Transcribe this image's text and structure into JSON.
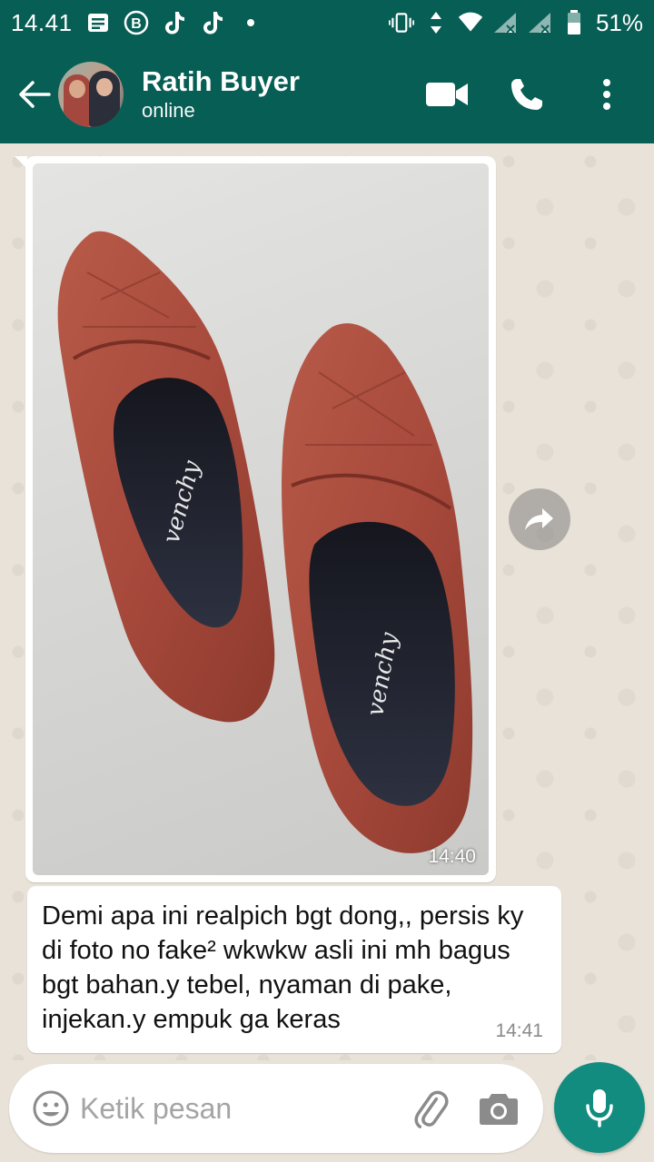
{
  "status_bar": {
    "time": "14.41",
    "battery": "51%",
    "icons": [
      "news-icon",
      "b-badge-icon",
      "tiktok-icon",
      "tiktok-icon",
      "dot-icon",
      "vibrate-icon",
      "data-arrows-icon",
      "wifi-icon",
      "signal-icon",
      "signal-icon",
      "battery-icon"
    ]
  },
  "header": {
    "contact_name": "Ratih Buyer",
    "contact_status": "online",
    "icons": [
      "back-arrow-icon",
      "video-call-icon",
      "phone-icon",
      "more-vert-icon"
    ]
  },
  "messages": [
    {
      "type": "image",
      "description_icon": "shoe-photo",
      "time": "14:40",
      "insole_brand": "venchy"
    },
    {
      "type": "text",
      "text": "Demi apa ini realpich bgt dong,, persis ky di foto no fake² wkwkw asli ini mh bagus bgt bahan.y tebel, nyaman di pake, injekan.y empuk ga keras",
      "time": "14:41"
    }
  ],
  "composer": {
    "placeholder": "Ketik pesan",
    "value": "",
    "icons": [
      "emoji-icon",
      "attach-icon",
      "camera-icon",
      "mic-icon"
    ]
  },
  "colors": {
    "primary": "#075e54",
    "accent": "#128c7e",
    "chat_bg": "#e9e2d8",
    "shoe": "#a84a3c"
  }
}
